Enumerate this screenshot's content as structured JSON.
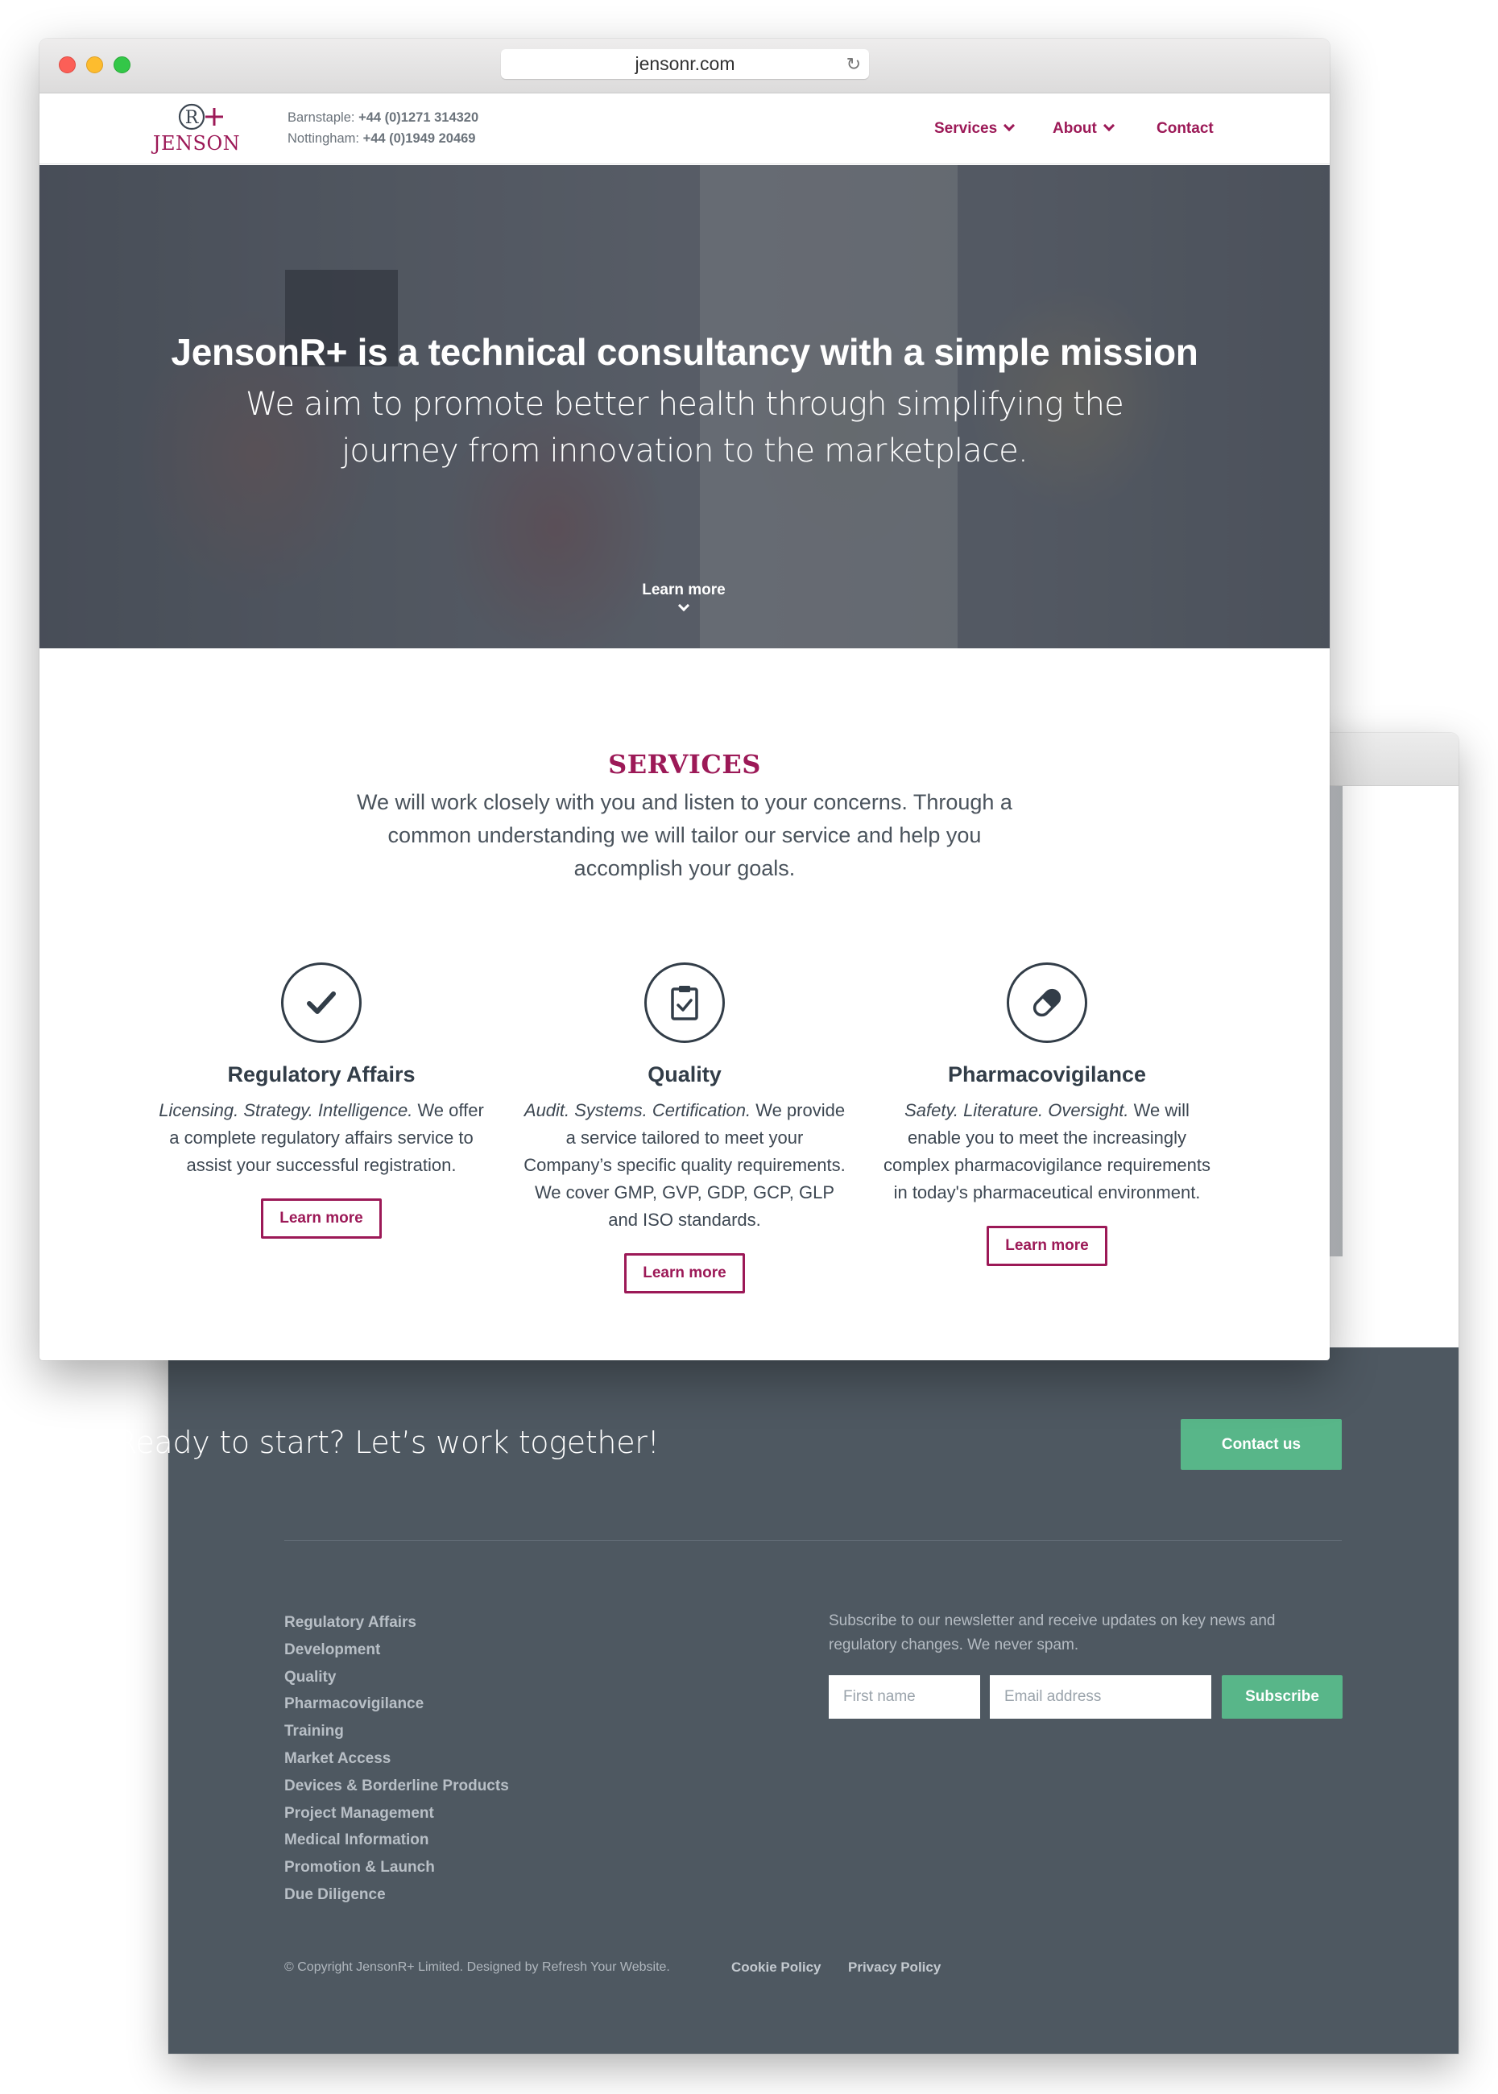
{
  "browser": {
    "url": "jensonr.com"
  },
  "header": {
    "logo_word": "JENSON",
    "phone_barnstaple_label": "Barnstaple:",
    "phone_barnstaple": "+44 (0)1271 314320",
    "phone_nottingham_label": "Nottingham:",
    "phone_nottingham": "+44 (0)1949 20469",
    "nav": {
      "services": "Services",
      "about": "About",
      "contact": "Contact"
    }
  },
  "hero": {
    "title": "JensonR+ is a technical consultancy with a simple mission",
    "subtitle": "We aim to promote better health through simplifying the journey from innovation to the marketplace.",
    "learn_more": "Learn more"
  },
  "services": {
    "heading": "SERVICES",
    "intro": "We will work closely with you and listen to your concerns. Through a common understanding we will tailor our service and help you accomplish your goals.",
    "cards": [
      {
        "icon": "checkmark-icon",
        "title": "Regulatory Affairs",
        "tagline": "Licensing. Strategy. Intelligence.",
        "text": " We offer a complete regulatory affairs service to assist your successful registration.",
        "button": "Learn more"
      },
      {
        "icon": "clipboard-check-icon",
        "title": "Quality",
        "tagline": "Audit. Systems. Certification.",
        "text": " We provide a service tailored to meet your Company’s specific quality requirements. We cover GMP, GVP, GDP, GCP, GLP and ISO standards.",
        "button": "Learn more"
      },
      {
        "icon": "pill-icon",
        "title": "Pharmacovigilance",
        "tagline": "Safety. Literature. Oversight.",
        "text": " We will enable you to meet the increasingly complex pharmacovigilance requirements in today's pharmaceutical environment.",
        "button": "Learn more"
      }
    ]
  },
  "footer": {
    "cta_text": "Ready to start? Let’s work together!",
    "cta_button": "Contact us",
    "links": [
      "Regulatory Affairs",
      "Development",
      "Quality",
      "Pharmacovigilance",
      "Training",
      "Market Access",
      "Devices & Borderline Products",
      "Project Management",
      "Medical Information",
      "Promotion & Launch",
      "Due Diligence"
    ],
    "newsletter_text": "Subscribe to our newsletter and receive updates on key news and regulatory changes. We never spam.",
    "first_name_placeholder": "First name",
    "email_placeholder": "Email address",
    "subscribe_button": "Subscribe",
    "copyright": "© Copyright JensonR+ Limited. Designed by Refresh Your Website.",
    "cookie_policy": "Cookie Policy",
    "privacy_policy": "Privacy Policy"
  },
  "colors": {
    "brand": "#9c1957",
    "accent_green": "#58b689",
    "footer_bg": "#4e5861"
  }
}
